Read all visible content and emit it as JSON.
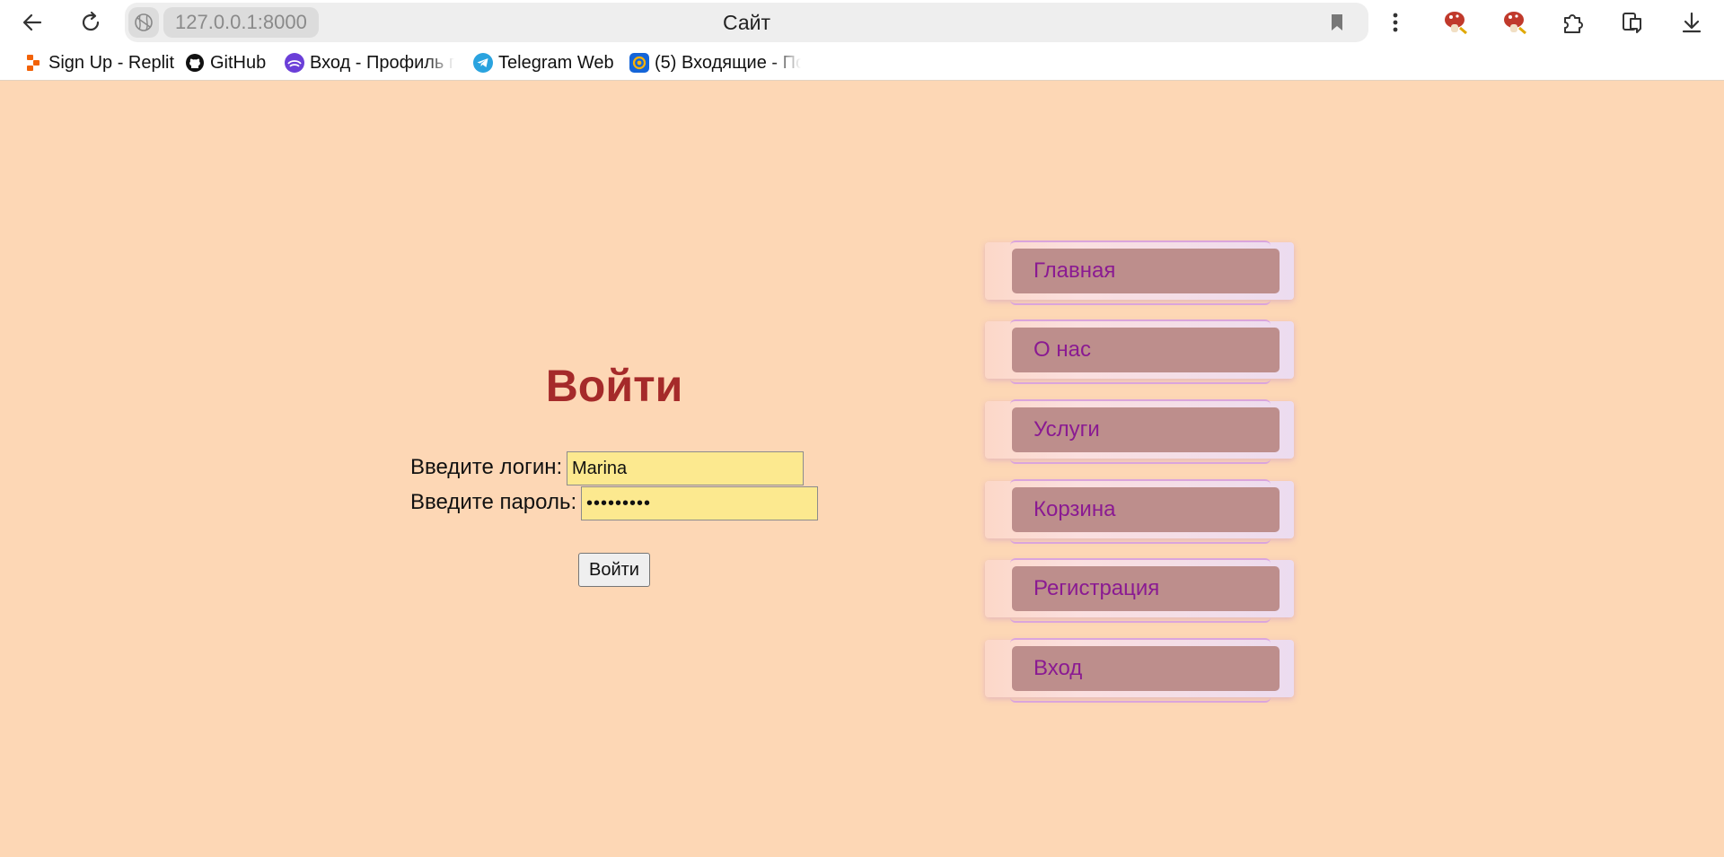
{
  "browser": {
    "url": "127.0.0.1:8000",
    "tab_title": "Сайт",
    "bookmarks": [
      {
        "label": "Sign Up - Replit",
        "icon": "replit-icon"
      },
      {
        "label": "GitHub",
        "icon": "github-icon"
      },
      {
        "label": "Вход - Профиль п",
        "icon": "profile-icon"
      },
      {
        "label": "Telegram Web",
        "icon": "telegram-icon"
      },
      {
        "label": "(5) Входящие - По",
        "icon": "mail-icon"
      }
    ]
  },
  "login": {
    "title": "Войти",
    "login_label": "Введите логин:",
    "login_value": "Marina",
    "password_label": "Введите пароль:",
    "password_value": "•••••••••",
    "submit_label": "Войти"
  },
  "nav": {
    "items": [
      {
        "label": "Главная"
      },
      {
        "label": "О нас"
      },
      {
        "label": "Услуги"
      },
      {
        "label": "Корзина"
      },
      {
        "label": "Регистрация"
      },
      {
        "label": "Вход"
      }
    ]
  },
  "colors": {
    "page_background": "#fdd7b5",
    "title": "#a52a2a",
    "input_background": "#fce98f",
    "nav_link_background": "#bd8e8c",
    "nav_link_text": "#8a1a92"
  }
}
